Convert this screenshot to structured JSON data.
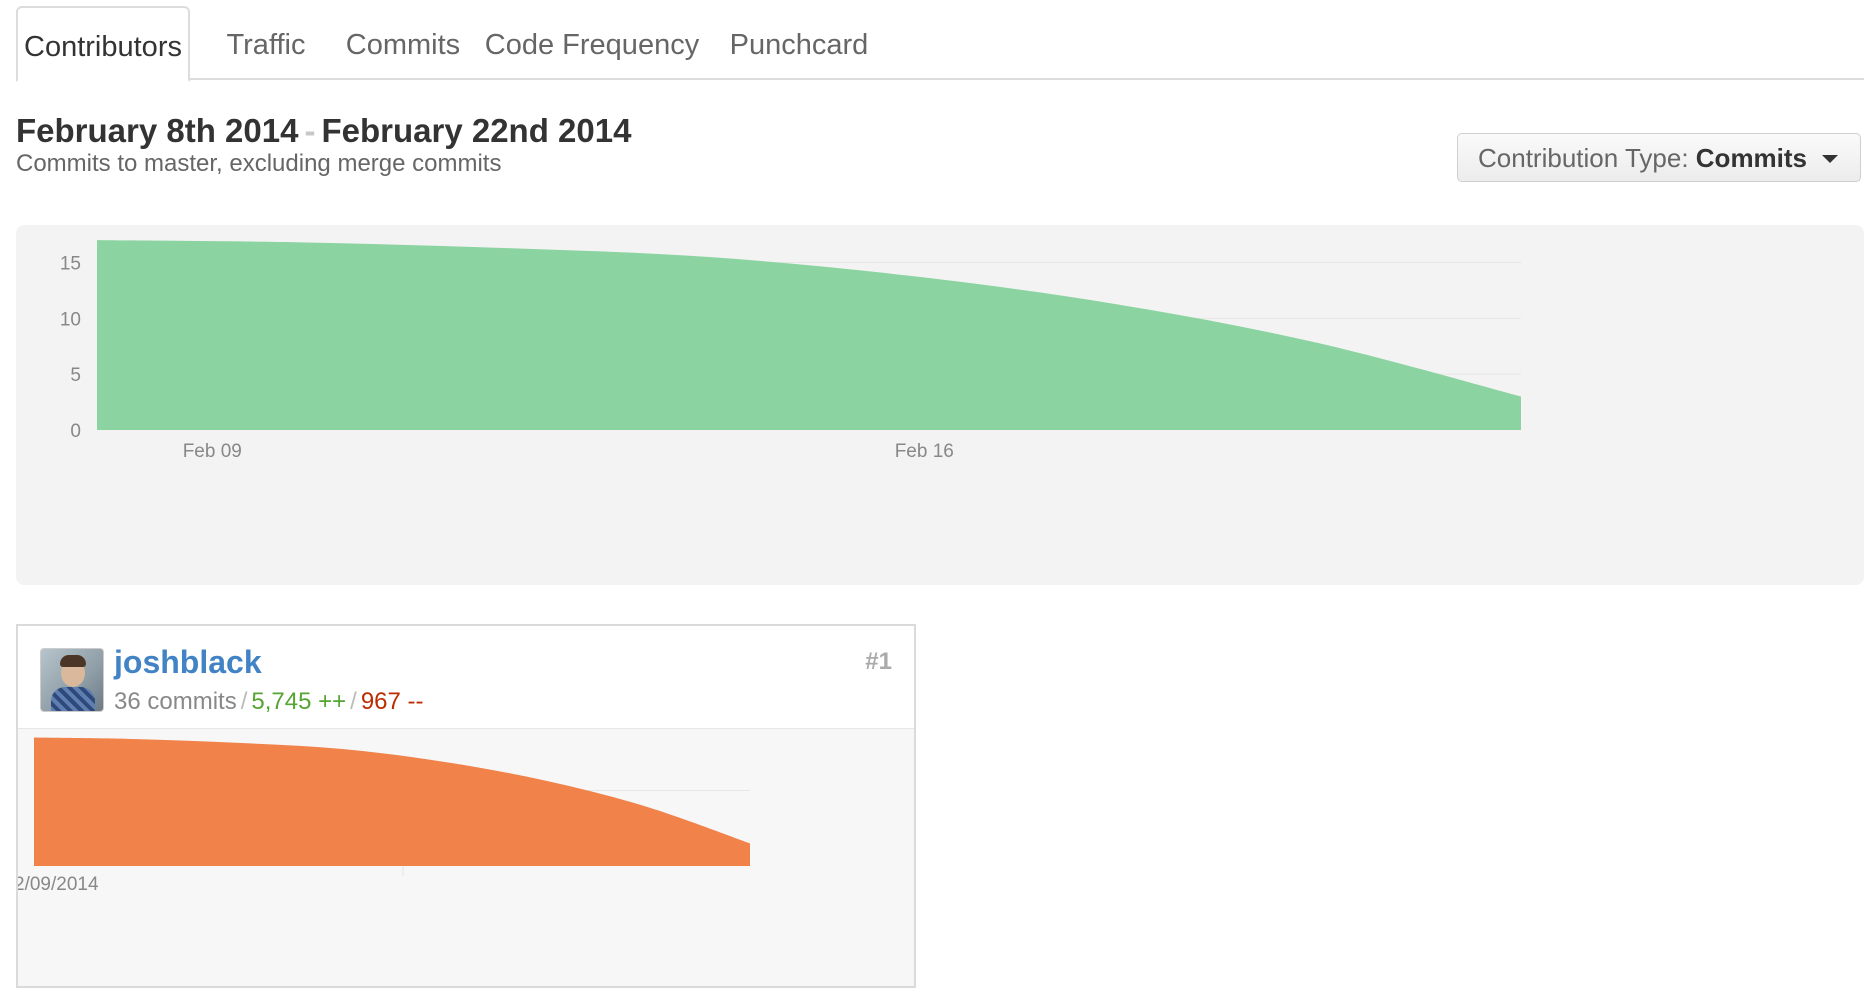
{
  "tabs": [
    {
      "label": "Contributors",
      "active": true
    },
    {
      "label": "Traffic",
      "active": false
    },
    {
      "label": "Commits",
      "active": false
    },
    {
      "label": "Code Frequency",
      "active": false
    },
    {
      "label": "Punchcard",
      "active": false
    }
  ],
  "header": {
    "range_start": "February 8th 2014",
    "range_separator": "-",
    "range_end": "February 22nd 2014",
    "subtitle": "Commits to master, excluding merge commits",
    "contribution_type_label": "Contribution Type:",
    "contribution_type_value": "Commits"
  },
  "chart_data": [
    {
      "type": "area",
      "x": [
        "2014-02-08",
        "2014-02-10",
        "2014-02-12",
        "2014-02-14",
        "2014-02-16",
        "2014-02-18",
        "2014-02-20",
        "2014-02-22"
      ],
      "y": [
        17,
        16.8,
        16.3,
        15.5,
        13.8,
        11.3,
        7.8,
        3
      ],
      "xticks": [
        "Feb 09",
        "Feb 16"
      ],
      "yticks": [
        "0",
        "5",
        "10",
        "15"
      ],
      "ylim": [
        0,
        18
      ],
      "color": "#8bd3a0",
      "grid": true
    },
    {
      "type": "area",
      "x": [
        "2014-02-08",
        "2014-02-10",
        "2014-02-12",
        "2014-02-14",
        "2014-02-16",
        "2014-02-18",
        "2014-02-20",
        "2014-02-22"
      ],
      "y": [
        17,
        16.8,
        16.3,
        15.5,
        13.8,
        11.3,
        7.8,
        3
      ],
      "xticks": [
        "2/09/2014"
      ],
      "ylim": [
        0,
        18
      ],
      "color": "#f0824a",
      "grid": true
    }
  ],
  "contributor": {
    "username": "joshblack",
    "commits": "36 commits",
    "additions": "5,745 ++",
    "deletions": "967 --",
    "rank": "#1",
    "avatar_icon": "user-avatar-icon"
  }
}
